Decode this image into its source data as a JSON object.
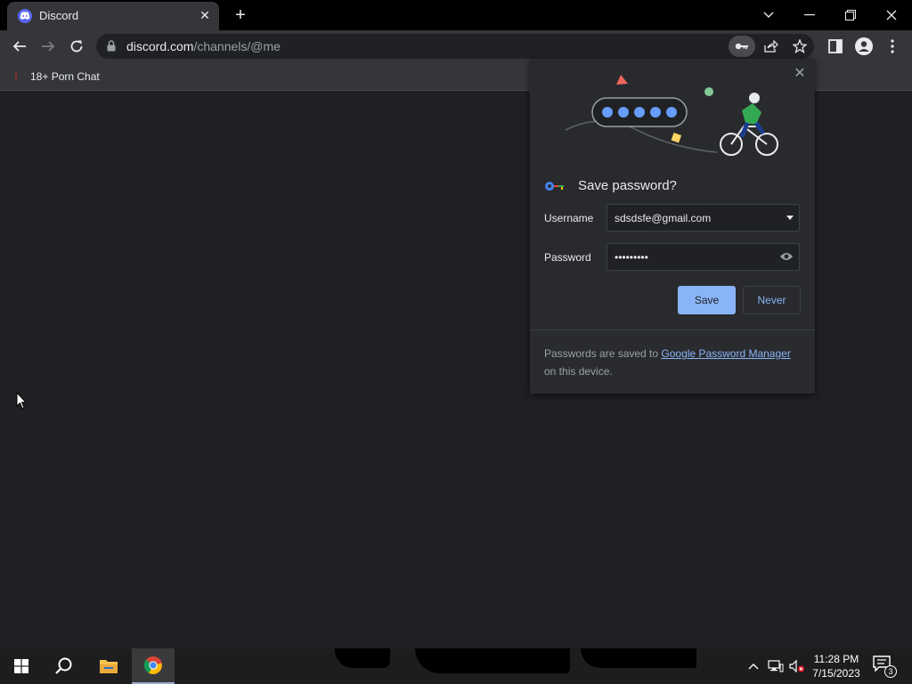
{
  "browser": {
    "tab_title": "Discord",
    "url_host": "discord.com",
    "url_path": "/channels/@me",
    "bookmark_label": "18+ Porn Chat"
  },
  "popup": {
    "heading": "Save password?",
    "username_label": "Username",
    "username_value": "sdsdsfe@gmail.com",
    "password_label": "Password",
    "password_value": "•••••••••",
    "save_label": "Save",
    "never_label": "Never",
    "footer_prefix": "Passwords are saved to ",
    "footer_link": "Google Password Manager",
    "footer_suffix": " on this device."
  },
  "taskbar": {
    "time": "11:28 PM",
    "date": "7/15/2023",
    "notification_count": "3"
  },
  "colors": {
    "accent": "#8ab4f8",
    "discord": "#5865f2"
  }
}
